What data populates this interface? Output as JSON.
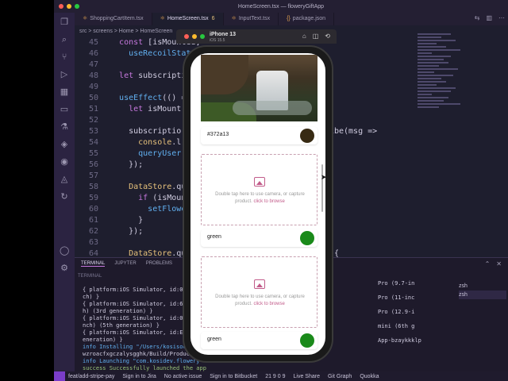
{
  "window": {
    "title": "HomeScreen.tsx — floweryGiftApp",
    "traffic_colors": [
      "#ff5f57",
      "#febc2e",
      "#28c840"
    ]
  },
  "activity_icons": [
    "files-icon",
    "search-icon",
    "source-control-icon",
    "run-debug-icon",
    "extensions-icon",
    "remote-icon",
    "testing-icon",
    "docker-icon",
    "gitlens-icon",
    "aws-icon",
    "live-share-icon",
    "accounts-icon",
    "settings-icon"
  ],
  "tabs": [
    {
      "label": "ShoppingCartItem.tsx",
      "active": false
    },
    {
      "label": "HomeScreen.tsx",
      "active": true,
      "modified": "6"
    },
    {
      "label": "InputText.tsx",
      "active": false
    },
    {
      "label": "package.json",
      "active": false
    }
  ],
  "breadcrumb": "src > screens > Home > HomeScreen",
  "code_lines": [
    {
      "num": "45",
      "text": "  const [isMounted] ="
    },
    {
      "num": "46",
      "text": "    useRecoilState(userDataModelState);"
    },
    {
      "num": "47",
      "text": ""
    },
    {
      "num": "48",
      "text": "  let subscripti"
    },
    {
      "num": "49",
      "text": ""
    },
    {
      "num": "50",
      "text": "  useEffect(() =>"
    },
    {
      "num": "51",
      "text": "    let isMount"
    },
    {
      "num": "52",
      "text": ""
    },
    {
      "num": "53",
      "text": "    subscriptio                     el).subscribe(msg =>"
    },
    {
      "num": "54",
      "text": "      console.l"
    },
    {
      "num": "55",
      "text": "      queryUser"
    },
    {
      "num": "56",
      "text": "    });"
    },
    {
      "num": "57",
      "text": ""
    },
    {
      "num": "58",
      "text": "    DataStore.qu                              {"
    },
    {
      "num": "59",
      "text": "      if (isMoun"
    },
    {
      "num": "60",
      "text": "        setFlowe"
    },
    {
      "num": "61",
      "text": "      }"
    },
    {
      "num": "62",
      "text": "    });"
    },
    {
      "num": "63",
      "text": ""
    },
    {
      "num": "64",
      "text": "    DataStore.qu                            => {"
    }
  ],
  "panel": {
    "tabs": [
      "TERMINAL",
      "JUPYTER",
      "PROBLEMS"
    ],
    "title": "TERMINAL",
    "terminal_lines": [
      {
        "cls": "",
        "text": "{ platform:iOS Simulator, id:0C74"
      },
      {
        "cls": "",
        "text": "ch) }"
      },
      {
        "cls": "",
        "text": "{ platform:iOS Simulator, id:6C32"
      },
      {
        "cls": "",
        "text": "h) (3rd generation) }"
      },
      {
        "cls": "",
        "text": "{ platform:iOS Simulator, id:0AFA"
      },
      {
        "cls": "",
        "text": "nch) (5th generation) }"
      },
      {
        "cls": "",
        "text": "{ platform:iOS Simulator, id:E987"
      },
      {
        "cls": "",
        "text": "eneration) }"
      },
      {
        "cls": "info",
        "text": "info Installing \"/Users/kosisoch"
      },
      {
        "cls": "",
        "text": "wzroacfxgczalysgghk/Build/Product"
      },
      {
        "cls": "info",
        "text": "info Launching \"com.kosidev.flowery"
      },
      {
        "cls": "succ",
        "text": "success Successfully launched the app"
      },
      {
        "cls": "",
        "text": "kosisochukwu@kosisocukwuMBP floweryGiftApp %"
      }
    ],
    "terminal_side": [
      "Pro (9.7-in",
      "",
      "Pro (11-inc",
      "",
      "Pro (12.9-i",
      "",
      "mini (6th g",
      "",
      "App-bzaykkklp",
      "",
      "",
      "",
      ""
    ],
    "shells": [
      "zsh",
      "zsh"
    ]
  },
  "statusbar": {
    "branch": "feat/add-stripe-pay",
    "jira": "Sign in to Jira",
    "issue": "No active issue",
    "bitbucket": "Sign in to Bitbucket",
    "problems": "21  9  0  9",
    "live_share": "Live Share",
    "git_graph": "Git Graph",
    "quokka": "Quokka"
  },
  "simulator": {
    "device": "iPhone 13",
    "os": "iOS 15.5"
  },
  "app": {
    "color_rows": [
      {
        "label": "#372a13",
        "swatch": "#372a13"
      },
      {
        "label": "green",
        "swatch": "#1a8a1a"
      },
      {
        "label": "green",
        "swatch": "#1a8a1a"
      }
    ],
    "upload_hint": "Double tap here to use camera, or capture product.",
    "upload_link": "click to browse"
  }
}
